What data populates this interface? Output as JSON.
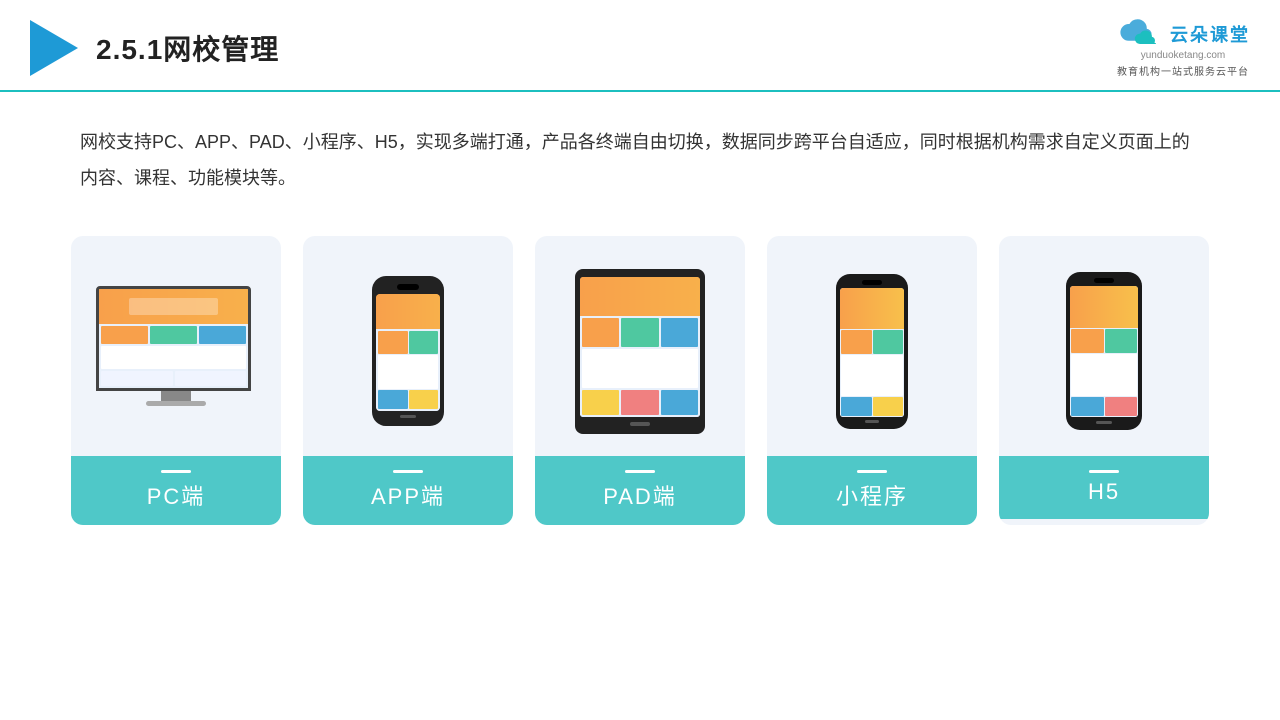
{
  "header": {
    "title": "2.5.1网校管理",
    "logo_text": "云朵课堂",
    "logo_domain": "yunduoketang.com",
    "logo_tagline": "教育机构一站式服务云平台"
  },
  "description": {
    "text": "网校支持PC、APP、PAD、小程序、H5，实现多端打通，产品各终端自由切换，数据同步跨平台自适应，同时根据机构需求自定义页面上的内容、课程、功能模块等。"
  },
  "cards": [
    {
      "id": "pc",
      "label": "PC端"
    },
    {
      "id": "app",
      "label": "APP端"
    },
    {
      "id": "pad",
      "label": "PAD端"
    },
    {
      "id": "miniapp",
      "label": "小程序"
    },
    {
      "id": "h5",
      "label": "H5"
    }
  ],
  "colors": {
    "accent": "#1CBFBF",
    "card_label_bg": "#4FC8C8",
    "header_border": "#1CBFBF",
    "triangle": "#1E9AD6",
    "text_dark": "#222222",
    "text_body": "#333333"
  }
}
